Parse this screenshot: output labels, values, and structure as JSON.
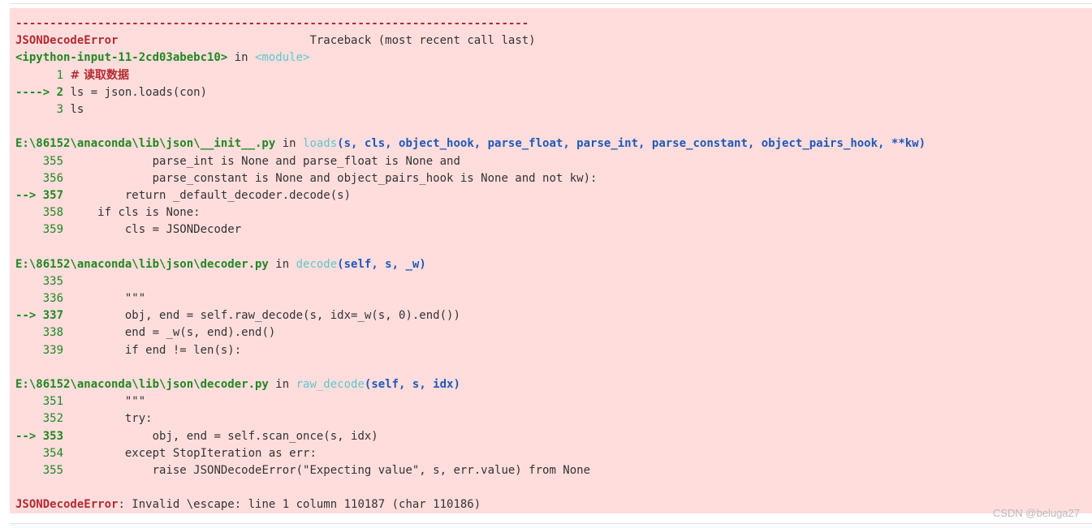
{
  "traceback": {
    "dash_line": "---------------------------------------------------------------------------",
    "error_name": "JSONDecodeError",
    "header_gap": "                            ",
    "header_text": "Traceback (most recent call last)",
    "frame1": {
      "file": "<ipython-input-11-2cd03abebc10>",
      "in_word": " in ",
      "func": "<module>",
      "lines": [
        {
          "arrow": "      ",
          "num": "1",
          "code_prefix": " ",
          "comment": "# 读取数据"
        },
        {
          "arrow": "----> ",
          "num": "2",
          "code": " ls = json.loads(con)"
        },
        {
          "arrow": "      ",
          "num": "3",
          "code": " ls"
        }
      ]
    },
    "frame2": {
      "file": "E:\\86152\\anaconda\\lib\\json\\__init__.py",
      "in_word": " in ",
      "func": "loads",
      "args": "(s, cls, object_hook, parse_float, parse_int, parse_constant, object_pairs_hook, **kw)",
      "lines": [
        {
          "arrow": "    ",
          "num": "355",
          "code": "             parse_int is None and parse_float is None and"
        },
        {
          "arrow": "    ",
          "num": "356",
          "code": "             parse_constant is None and object_pairs_hook is None and not kw):"
        },
        {
          "arrow": "--> ",
          "num": "357",
          "code": "         return _default_decoder.decode(s)"
        },
        {
          "arrow": "    ",
          "num": "358",
          "code": "     if cls is None:"
        },
        {
          "arrow": "    ",
          "num": "359",
          "code": "         cls = JSONDecoder"
        }
      ]
    },
    "frame3": {
      "file": "E:\\86152\\anaconda\\lib\\json\\decoder.py",
      "in_word": " in ",
      "func": "decode",
      "args": "(self, s, _w)",
      "lines": [
        {
          "arrow": "    ",
          "num": "335",
          "code": ""
        },
        {
          "arrow": "    ",
          "num": "336",
          "code": "         \"\"\""
        },
        {
          "arrow": "--> ",
          "num": "337",
          "code": "         obj, end = self.raw_decode(s, idx=_w(s, 0).end())"
        },
        {
          "arrow": "    ",
          "num": "338",
          "code": "         end = _w(s, end).end()"
        },
        {
          "arrow": "    ",
          "num": "339",
          "code": "         if end != len(s):"
        }
      ]
    },
    "frame4": {
      "file": "E:\\86152\\anaconda\\lib\\json\\decoder.py",
      "in_word": " in ",
      "func": "raw_decode",
      "args": "(self, s, idx)",
      "lines": [
        {
          "arrow": "    ",
          "num": "351",
          "code": "         \"\"\""
        },
        {
          "arrow": "    ",
          "num": "352",
          "code": "         try:"
        },
        {
          "arrow": "--> ",
          "num": "353",
          "code": "             obj, end = self.scan_once(s, idx)"
        },
        {
          "arrow": "    ",
          "num": "354",
          "code": "         except StopIteration as err:"
        },
        {
          "arrow": "    ",
          "num": "355",
          "code": "             raise JSONDecodeError(\"Expecting value\", s, err.value) from None"
        }
      ]
    },
    "final_error_name": "JSONDecodeError",
    "final_message": ": Invalid \\escape: line 1 column 110187 (char 110186)"
  },
  "watermark": "CSDN @beluga27",
  "colors": {
    "background": "#ffdddd",
    "error_red": "#b22b31",
    "frame_green": "#218721",
    "func_cyan": "#60c6c8",
    "args_blue": "#1f59b8",
    "paren_brown": "#af5f00"
  }
}
